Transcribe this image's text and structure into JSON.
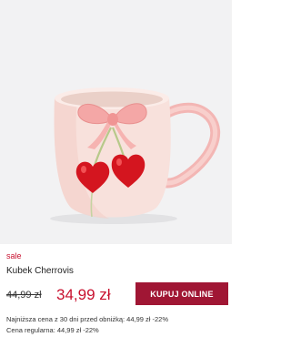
{
  "product": {
    "badge": "sale",
    "name": "Kubek Cherrovis",
    "old_price": "44,99 zł",
    "new_price": "34,99 zł",
    "buy_label": "KUPUJ ONLINE",
    "lowest_price_note": "Najniższa cena z 30 dni przed obniżką: 44,99 zł -22%",
    "regular_price_note": "Cena regularna: 44,99 zł -22%"
  },
  "colors": {
    "accent": "#c8102e",
    "button": "#a01634",
    "image_background": "#f2f2f3",
    "mug": "#f7dcd6",
    "bow": "#f4a7a6",
    "cherry": "#d4151f"
  }
}
